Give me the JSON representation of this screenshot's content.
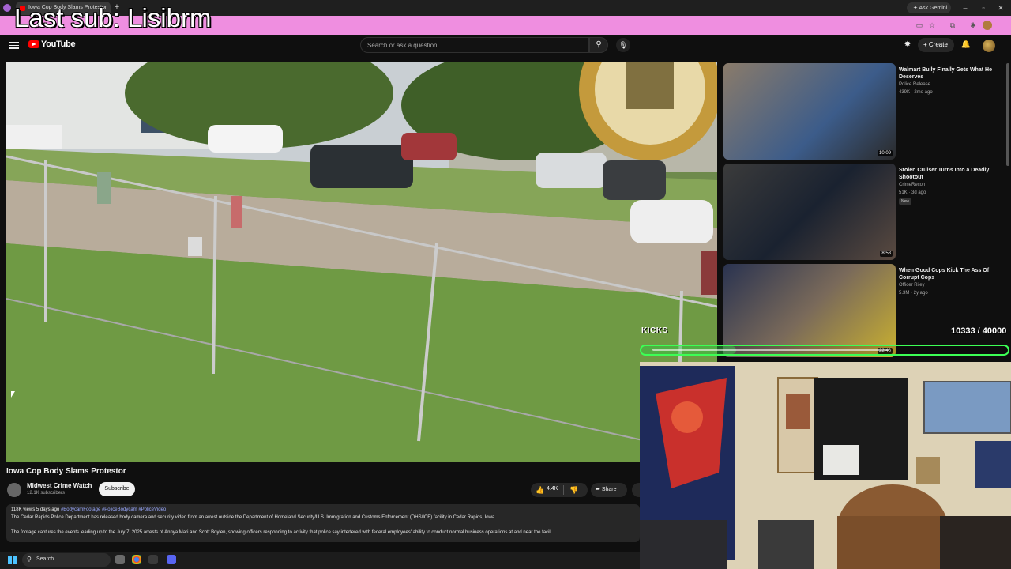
{
  "overlay": {
    "last_sub": "Last sub: Lisibrm"
  },
  "browser": {
    "tab_title": "Iowa Cop Body Slams Protestor",
    "ask_gemini": "Ask Gemini",
    "icons": [
      "profile-icon",
      "new-tab-icon",
      "minimize-icon",
      "maximize-icon",
      "close-icon",
      "bookmark-icon",
      "extensions-icon"
    ]
  },
  "youtube": {
    "logo": "YouTube",
    "search_placeholder": "Search or ask a question",
    "create_label": "Create",
    "header_icons": [
      "menu-icon",
      "search-icon",
      "mic-icon",
      "notifications-icon",
      "bell-icon"
    ]
  },
  "video": {
    "title": "Iowa Cop Body Slams Protestor",
    "channel": "Midwest Crime Watch",
    "subscribers": "12.1K subscribers",
    "subscribe_label": "Subscribe",
    "likes": "4.4K",
    "share_label": "Share",
    "views_date": "118K views  5 days ago",
    "hashtags": "#BodycamFootage #PoliceBodycam #PoliceVideo",
    "description_1": "The Cedar Rapids Police Department has released body camera and security video from an arrest outside the Department of Homeland Security/U.S. Immigration and Customs Enforcement (DHS/ICE) facility in Cedar Rapids, Iowa.",
    "description_2": "The footage captures the events leading up to the July 7, 2025 arrests of Annya Mari and Scott Boylen, showing officers responding to activity that police say interfered with federal employees' ability to conduct normal business operations at and near the facili"
  },
  "recommendations": [
    {
      "title": "Walmart Bully Finally Gets What He Deserves",
      "channel": "Police Release",
      "stats": "439K · 2mo ago",
      "duration": "10:09"
    },
    {
      "title": "Stolen Cruiser Turns Into a Deadly Shootout",
      "channel": "CrimeRecon",
      "stats": "51K · 3d ago",
      "badge": "New",
      "duration": "8:58"
    },
    {
      "title": "When Good Cops Kick The Ass Of Corrupt Cops",
      "channel": "Officer Riley",
      "stats": "5.3M · 2y ago",
      "duration": "22:46"
    }
  ],
  "stream": {
    "goal_label": "KICKS",
    "goal_count": "10333 / 40000",
    "goal_progress": 0.258
  },
  "taskbar": {
    "search_label": "Search"
  },
  "colors": {
    "accent_red": "#ff0000",
    "goal_green": "#3cff55",
    "chrome_pink": "#ef8ee0"
  }
}
